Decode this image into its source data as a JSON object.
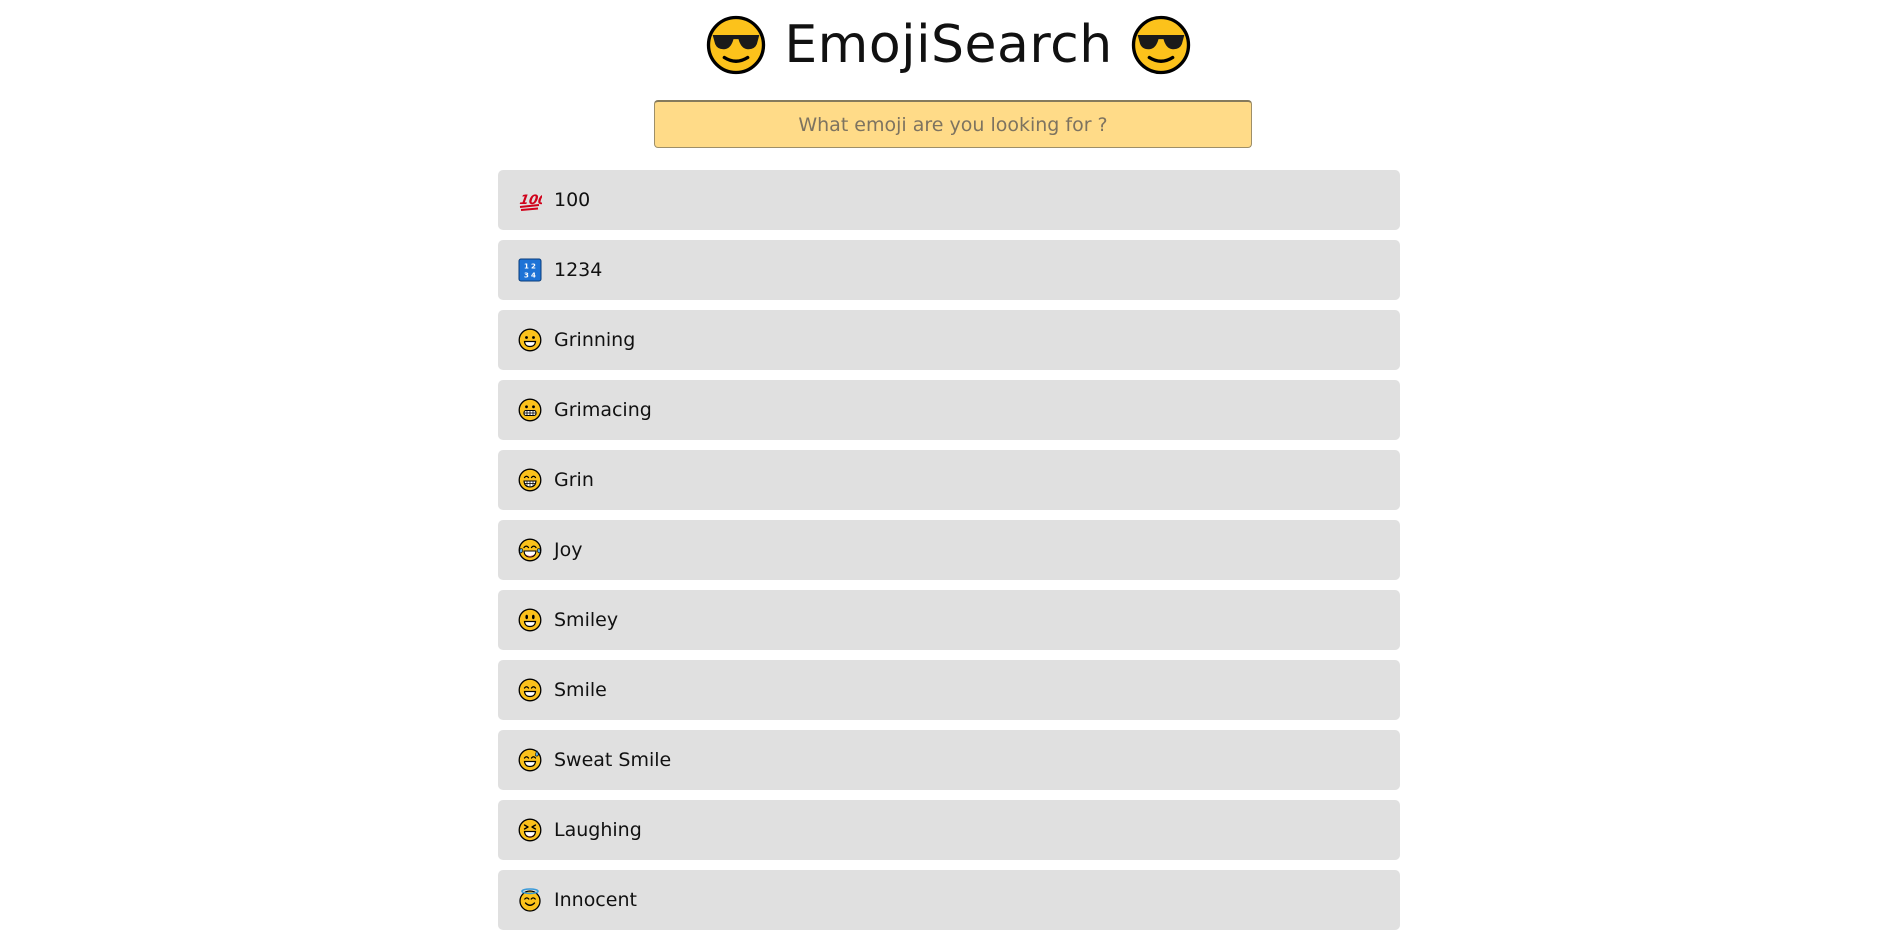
{
  "header": {
    "title": "EmojiSearch",
    "left_icon": "sunglasses-face-icon",
    "right_icon": "sunglasses-face-icon"
  },
  "search": {
    "placeholder": "What emoji are you looking for ?",
    "value": ""
  },
  "colors": {
    "search_background": "#ffdb88",
    "row_background": "#e0e0e0",
    "emoji_face": "#fcc21b"
  },
  "emoji_list": [
    {
      "label": "100",
      "icon": "hundred-points-icon"
    },
    {
      "label": "1234",
      "icon": "input-numbers-icon"
    },
    {
      "label": "Grinning",
      "icon": "grinning-face-icon"
    },
    {
      "label": "Grimacing",
      "icon": "grimacing-face-icon"
    },
    {
      "label": "Grin",
      "icon": "beaming-face-icon"
    },
    {
      "label": "Joy",
      "icon": "tears-of-joy-face-icon"
    },
    {
      "label": "Smiley",
      "icon": "smiley-face-icon"
    },
    {
      "label": "Smile",
      "icon": "smile-face-icon"
    },
    {
      "label": "Sweat Smile",
      "icon": "sweat-smile-face-icon"
    },
    {
      "label": "Laughing",
      "icon": "laughing-face-icon"
    },
    {
      "label": "Innocent",
      "icon": "innocent-face-icon"
    }
  ]
}
